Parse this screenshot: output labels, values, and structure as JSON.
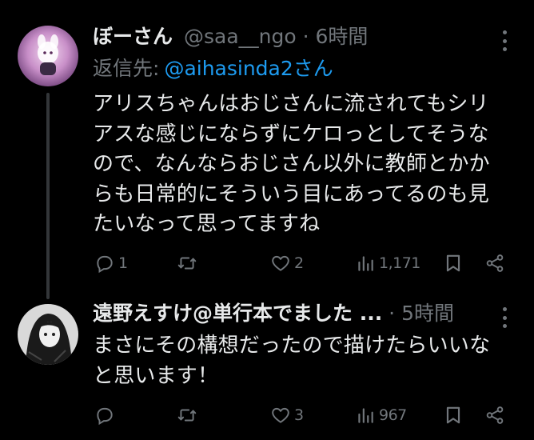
{
  "tweets": [
    {
      "author": {
        "name": "ぼーさん",
        "handle": "@saa__ngo"
      },
      "dot": "·",
      "time": "6時間",
      "reply_to": {
        "label": "返信先:",
        "mention": "@aihasinda2さん"
      },
      "text": "アリスちゃんはおじさんに流されてもシリ\nアスな感じにならずにケロっとしてそうな\nので、なんならおじさん以外に教師とかか\nらも日常的にそういう目にあってるのも見\nたいなって思ってますね",
      "stats": {
        "replies": "1",
        "retweets": "",
        "likes": "2",
        "views": "1,171"
      }
    },
    {
      "author": {
        "name": "遠野えすけ@単行本でました ...",
        "handle": ""
      },
      "dot": "·",
      "time": "5時間",
      "text": "まさにその構想だったので描けたらいいな\nと思います！",
      "stats": {
        "replies": "",
        "retweets": "",
        "likes": "3",
        "views": "967"
      }
    }
  ],
  "icons": [
    "more-icon",
    "reply-icon",
    "retweet-icon",
    "like-icon",
    "views-icon",
    "bookmark-icon",
    "share-icon"
  ],
  "colors": {
    "background": "#000000",
    "text": "#e7e9ea",
    "muted": "#71767b",
    "link": "#1d9bf0",
    "thread_line": "#333639"
  }
}
